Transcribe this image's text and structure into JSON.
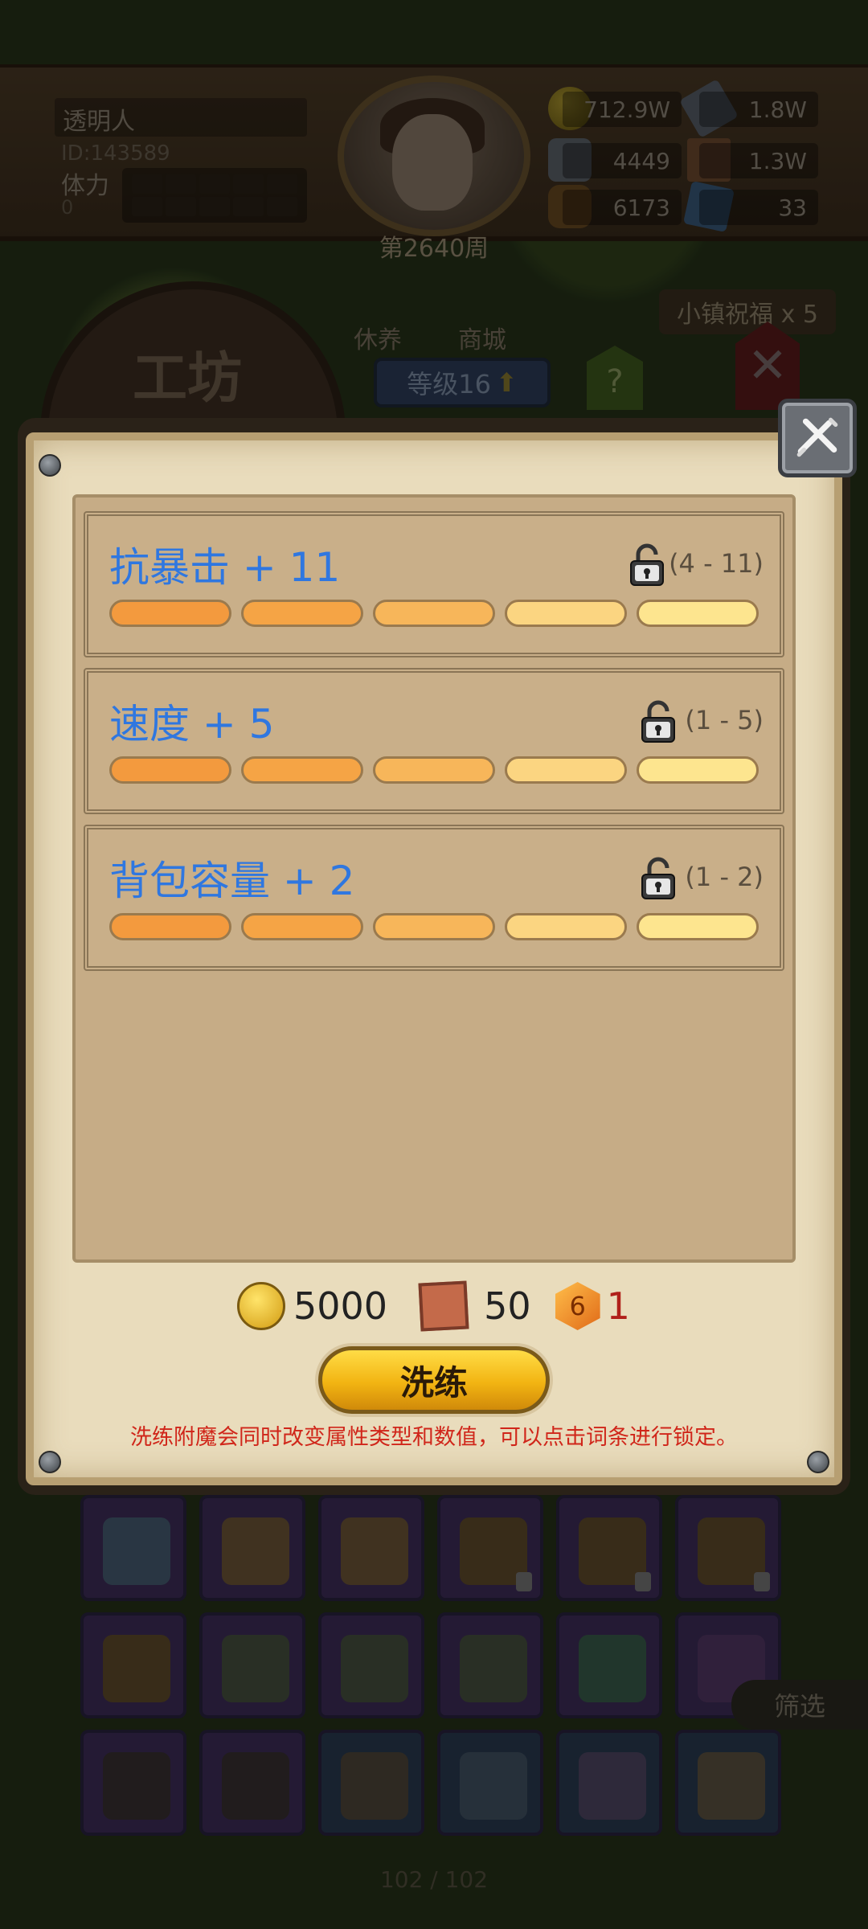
{
  "hud": {
    "player_name": "透明人",
    "player_id": "ID:143589",
    "stamina_label": "体力",
    "stamina_value": "0",
    "week": "第2640周",
    "resources": {
      "gold": "712.9W",
      "iron": "1.8W",
      "ore": "4449",
      "scroll": "1.3W",
      "wood": "6173",
      "crystal": "33"
    }
  },
  "background_menu": {
    "workshop_title": "工坊",
    "rest_label": "休养",
    "shop_label": "商城",
    "level_label": "等级16",
    "help_label": "?",
    "blessing_label": "小镇祝福 x 5"
  },
  "dialog": {
    "stats": [
      {
        "text": "抗暴击 + 11",
        "range": "(4 - 11)"
      },
      {
        "text": "速度 + 5",
        "range": "(1 - 5)"
      },
      {
        "text": "背包容量 + 2",
        "range": "(1 - 2)"
      }
    ],
    "cost": {
      "gold": "5000",
      "scroll": "50",
      "gem_icon_label": "6",
      "gem": "1"
    },
    "refine_button": "洗练",
    "hint": "洗练附魔会同时改变属性类型和数值，可以点击词条进行锁定。"
  },
  "inventory": {
    "filter_label": "筛选",
    "page_count": "102 / 102"
  },
  "colors": {
    "stat_text": "#2f77e0",
    "hint_text": "#d0261a",
    "bar_colors": [
      "#f39a3e",
      "#f5a445",
      "#f7b65a",
      "#fbd581",
      "#fde58f"
    ]
  },
  "icons": [
    "close-icon",
    "lock-icon",
    "gold-coin-icon",
    "scroll-icon",
    "gem-icon"
  ]
}
